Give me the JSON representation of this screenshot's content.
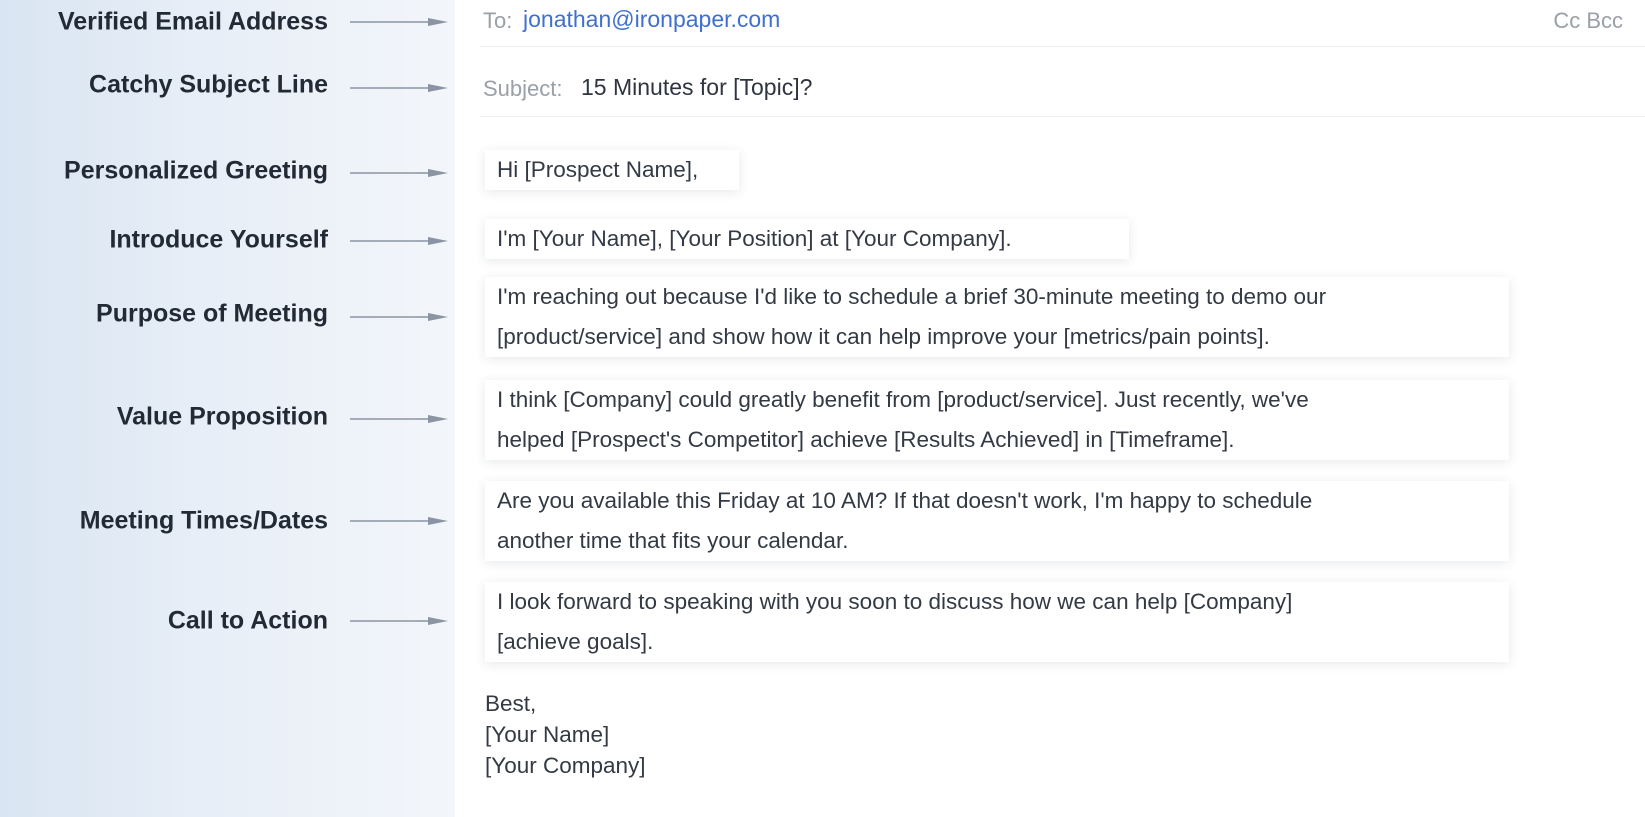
{
  "labels": [
    "Verified Email Address",
    "Catchy Subject Line",
    "Personalized Greeting",
    "Introduce Yourself",
    "Purpose of Meeting",
    "Value Proposition",
    "Meeting Times/Dates",
    "Call to Action"
  ],
  "email": {
    "to_label": "To:",
    "to_value": "jonathan@ironpaper.com",
    "cc_bcc": "Cc Bcc",
    "subject_label": "Subject:",
    "subject_value": "15 Minutes for [Topic]?",
    "greeting": "Hi [Prospect Name],",
    "intro": "I'm [Your Name], [Your Position] at [Your Company].",
    "purpose": [
      "I'm reaching out because I'd like to schedule a brief 30-minute meeting to demo our",
      "[product/service] and show how it can help improve your [metrics/pain points]."
    ],
    "value": [
      "I think [Company] could greatly benefit from [product/service]. Just recently, we've",
      "helped [Prospect's Competitor] achieve [Results Achieved] in [Timeframe]."
    ],
    "times": [
      "Are you available this Friday at 10 AM? If that doesn't work, I'm happy to schedule",
      "another time that fits your calendar."
    ],
    "cta": [
      "I look forward to speaking with you soon to discuss how we can help [Company]",
      "[achieve goals]."
    ],
    "signature": [
      "Best,",
      "[Your Name]",
      "[Your Company]"
    ]
  },
  "colors": {
    "panel": "#dde7f3",
    "accent_link": "#3f6fd0",
    "label_text": "#222a36",
    "arrow": "#8a94a3"
  }
}
